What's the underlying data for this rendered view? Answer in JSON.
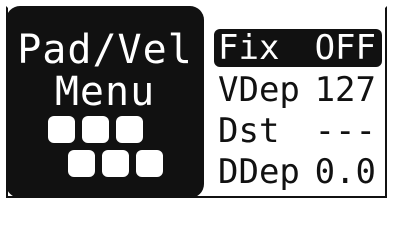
{
  "menu": {
    "title_line1": "Pad/Vel",
    "title_line2": "Menu",
    "pad_icon": "pad-grid-icon"
  },
  "params": [
    {
      "name": "Fix",
      "value": "OFF",
      "selected": true
    },
    {
      "name": "VDep",
      "value": "127",
      "selected": false
    },
    {
      "name": "Dst",
      "value": "---",
      "selected": false
    },
    {
      "name": "DDep",
      "value": "0.0",
      "selected": false
    }
  ],
  "colors": {
    "foreground": "#111111",
    "background": "#ffffff"
  }
}
